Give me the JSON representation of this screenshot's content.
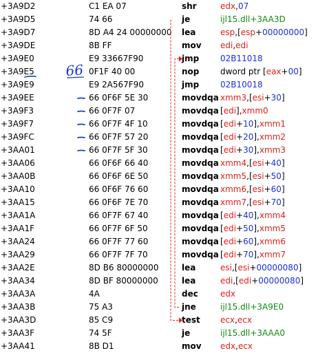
{
  "rows": [
    {
      "addr": "+3A9D2",
      "bytes": "C1 EA 07",
      "mnem": "shr",
      "ops": [
        [
          "reg",
          "edx"
        ],
        [
          "plain",
          ","
        ],
        [
          "num",
          "07"
        ]
      ]
    },
    {
      "addr": "+3A9D5",
      "bytes": "74 66",
      "mnem": "je",
      "ops": [
        [
          "sym",
          "ijl15.dll+3AA3D"
        ]
      ]
    },
    {
      "addr": "+3A9D7",
      "bytes": "8D A4 24 00000000",
      "mnem": "lea",
      "ops": [
        [
          "reg",
          "esp"
        ],
        [
          "plain",
          ",["
        ],
        [
          "reg",
          "esp"
        ],
        [
          "plain",
          "+"
        ],
        [
          "num",
          "00000000"
        ],
        [
          "plain",
          "]"
        ]
      ]
    },
    {
      "addr": "+3A9DE",
      "bytes": "8B FF",
      "mnem": "mov",
      "ops": [
        [
          "reg",
          "edi"
        ],
        [
          "plain",
          ","
        ],
        [
          "reg",
          "edi"
        ]
      ]
    },
    {
      "addr": "+3A9E0",
      "bytes": "E9 33667F90",
      "mnem": "jmp",
      "ops": [
        [
          "num",
          "02B11018"
        ]
      ]
    },
    {
      "addr": "+3A9E5",
      "bytes": "0F1F 40 00",
      "mnem": "nop",
      "ops": [
        [
          "kw",
          "dword ptr "
        ],
        [
          "plain",
          "["
        ],
        [
          "reg",
          "eax"
        ],
        [
          "plain",
          "+"
        ],
        [
          "num",
          "00"
        ],
        [
          "plain",
          "]"
        ]
      ]
    },
    {
      "addr": "+3A9E9",
      "bytes": "E9 2A567F90",
      "mnem": "jmp",
      "ops": [
        [
          "num",
          "02B10018"
        ]
      ]
    },
    {
      "addr": "+3A9EE",
      "bytes": "66 0F6F 5E 30",
      "mnem": "movdqa",
      "ops": [
        [
          "reg",
          "xmm3"
        ],
        [
          "plain",
          ",["
        ],
        [
          "reg",
          "esi"
        ],
        [
          "plain",
          "+"
        ],
        [
          "num",
          "30"
        ],
        [
          "plain",
          "]"
        ]
      ]
    },
    {
      "addr": "+3A9F3",
      "bytes": "66 0F7F 07",
      "mnem": "movdqa",
      "ops": [
        [
          "plain",
          "["
        ],
        [
          "reg",
          "edi"
        ],
        [
          "plain",
          "],"
        ],
        [
          "reg",
          "xmm0"
        ]
      ]
    },
    {
      "addr": "+3A9F7",
      "bytes": "66 0F7F 4F 10",
      "mnem": "movdqa",
      "ops": [
        [
          "plain",
          "["
        ],
        [
          "reg",
          "edi"
        ],
        [
          "plain",
          "+"
        ],
        [
          "num",
          "10"
        ],
        [
          "plain",
          "],"
        ],
        [
          "reg",
          "xmm1"
        ]
      ]
    },
    {
      "addr": "+3A9FC",
      "bytes": "66 0F7F 57 20",
      "mnem": "movdqa",
      "ops": [
        [
          "plain",
          "["
        ],
        [
          "reg",
          "edi"
        ],
        [
          "plain",
          "+"
        ],
        [
          "num",
          "20"
        ],
        [
          "plain",
          "],"
        ],
        [
          "reg",
          "xmm2"
        ]
      ]
    },
    {
      "addr": "+3AA01",
      "bytes": "66 0F7F 5F 30",
      "mnem": "movdqa",
      "ops": [
        [
          "plain",
          "["
        ],
        [
          "reg",
          "edi"
        ],
        [
          "plain",
          "+"
        ],
        [
          "num",
          "30"
        ],
        [
          "plain",
          "],"
        ],
        [
          "reg",
          "xmm3"
        ]
      ]
    },
    {
      "addr": "+3AA06",
      "bytes": "66 0F6F 66 40",
      "mnem": "movdqa",
      "ops": [
        [
          "reg",
          "xmm4"
        ],
        [
          "plain",
          ",["
        ],
        [
          "reg",
          "esi"
        ],
        [
          "plain",
          "+"
        ],
        [
          "num",
          "40"
        ],
        [
          "plain",
          "]"
        ]
      ]
    },
    {
      "addr": "+3AA0B",
      "bytes": "66 0F6F 6E 50",
      "mnem": "movdqa",
      "ops": [
        [
          "reg",
          "xmm5"
        ],
        [
          "plain",
          ",["
        ],
        [
          "reg",
          "esi"
        ],
        [
          "plain",
          "+"
        ],
        [
          "num",
          "50"
        ],
        [
          "plain",
          "]"
        ]
      ]
    },
    {
      "addr": "+3AA10",
      "bytes": "66 0F6F 76 60",
      "mnem": "movdqa",
      "ops": [
        [
          "reg",
          "xmm6"
        ],
        [
          "plain",
          ",["
        ],
        [
          "reg",
          "esi"
        ],
        [
          "plain",
          "+"
        ],
        [
          "num",
          "60"
        ],
        [
          "plain",
          "]"
        ]
      ]
    },
    {
      "addr": "+3AA15",
      "bytes": "66 0F6F 7E 70",
      "mnem": "movdqa",
      "ops": [
        [
          "reg",
          "xmm7"
        ],
        [
          "plain",
          ",["
        ],
        [
          "reg",
          "esi"
        ],
        [
          "plain",
          "+"
        ],
        [
          "num",
          "70"
        ],
        [
          "plain",
          "]"
        ]
      ]
    },
    {
      "addr": "+3AA1A",
      "bytes": "66 0F7F 67 40",
      "mnem": "movdqa",
      "ops": [
        [
          "plain",
          "["
        ],
        [
          "reg",
          "edi"
        ],
        [
          "plain",
          "+"
        ],
        [
          "num",
          "40"
        ],
        [
          "plain",
          "],"
        ],
        [
          "reg",
          "xmm4"
        ]
      ]
    },
    {
      "addr": "+3AA1F",
      "bytes": "66 0F7F 6F 50",
      "mnem": "movdqa",
      "ops": [
        [
          "plain",
          "["
        ],
        [
          "reg",
          "edi"
        ],
        [
          "plain",
          "+"
        ],
        [
          "num",
          "50"
        ],
        [
          "plain",
          "],"
        ],
        [
          "reg",
          "xmm5"
        ]
      ]
    },
    {
      "addr": "+3AA24",
      "bytes": "66 0F7F 77 60",
      "mnem": "movdqa",
      "ops": [
        [
          "plain",
          "["
        ],
        [
          "reg",
          "edi"
        ],
        [
          "plain",
          "+"
        ],
        [
          "num",
          "60"
        ],
        [
          "plain",
          "],"
        ],
        [
          "reg",
          "xmm6"
        ]
      ]
    },
    {
      "addr": "+3AA29",
      "bytes": "66 0F7F 7F 70",
      "mnem": "movdqa",
      "ops": [
        [
          "plain",
          "["
        ],
        [
          "reg",
          "edi"
        ],
        [
          "plain",
          "+"
        ],
        [
          "num",
          "70"
        ],
        [
          "plain",
          "],"
        ],
        [
          "reg",
          "xmm7"
        ]
      ]
    },
    {
      "addr": "+3AA2E",
      "bytes": "8D B6 80000000",
      "mnem": "lea",
      "ops": [
        [
          "reg",
          "esi"
        ],
        [
          "plain",
          ",["
        ],
        [
          "reg",
          "esi"
        ],
        [
          "plain",
          "+"
        ],
        [
          "num",
          "00000080"
        ],
        [
          "plain",
          "]"
        ]
      ]
    },
    {
      "addr": "+3AA34",
      "bytes": "8D BF 80000000",
      "mnem": "lea",
      "ops": [
        [
          "reg",
          "edi"
        ],
        [
          "plain",
          ",["
        ],
        [
          "reg",
          "edi"
        ],
        [
          "plain",
          "+"
        ],
        [
          "num",
          "00000080"
        ],
        [
          "plain",
          "]"
        ]
      ]
    },
    {
      "addr": "+3AA3A",
      "bytes": "4A",
      "mnem": "dec",
      "ops": [
        [
          "reg",
          "edx"
        ]
      ]
    },
    {
      "addr": "+3AA3B",
      "bytes": "75 A3",
      "mnem": "jne",
      "ops": [
        [
          "sym",
          "ijl15.dll+3A9E0"
        ]
      ]
    },
    {
      "addr": "+3AA3D",
      "bytes": "85 C9",
      "mnem": "test",
      "ops": [
        [
          "reg",
          "ecx"
        ],
        [
          "plain",
          ","
        ],
        [
          "reg",
          "ecx"
        ]
      ]
    },
    {
      "addr": "+3AA3F",
      "bytes": "74 5F",
      "mnem": "je",
      "ops": [
        [
          "sym",
          "ijl15.dll+3AAA0"
        ]
      ]
    },
    {
      "addr": "+3AA41",
      "bytes": "8B D1",
      "mnem": "mov",
      "ops": [
        [
          "reg",
          "edx"
        ],
        [
          "plain",
          ","
        ],
        [
          "reg",
          "ecx"
        ]
      ]
    }
  ],
  "annotations": {
    "handwritten": "66"
  },
  "colors": {
    "register": "#e0201a",
    "number": "#1a30d8",
    "symbol": "#108a10",
    "jump_arrow": "#e0201a",
    "ink": "#1a3cc8"
  }
}
